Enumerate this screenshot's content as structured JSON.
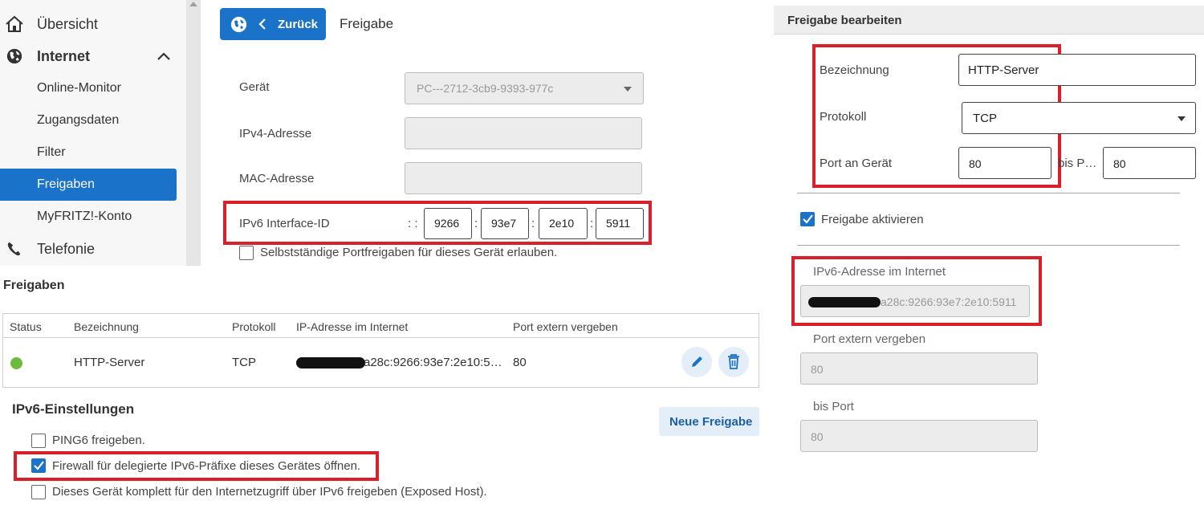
{
  "sidebar": {
    "overview": "Übersicht",
    "internet": "Internet",
    "items": [
      "Online-Monitor",
      "Zugangsdaten",
      "Filter",
      "Freigaben",
      "MyFRITZ!-Konto"
    ],
    "telephony": "Telefonie",
    "active_item": "Freigaben"
  },
  "topbar": {
    "back_label": "Zurück",
    "breadcrumb": "Freigabe"
  },
  "device_form": {
    "device_label": "Gerät",
    "device_value": "PC---2712-3cb9-9393-977c",
    "ipv4_label": "IPv4-Adresse",
    "mac_label": "MAC-Adresse",
    "ipv6_label": "IPv6 Interface-ID",
    "ipv6_prefix": ": :",
    "ipv6_parts": [
      "9266",
      "93e7",
      "2e10",
      "5911"
    ],
    "ipv6_sep": ":",
    "self_release_label": "Selbstständige Portfreigaben für dieses Gerät erlauben."
  },
  "shares": {
    "heading": "Freigaben",
    "columns": [
      "Status",
      "Bezeichnung",
      "Protokoll",
      "IP-Adresse im Internet",
      "Port extern vergeben"
    ],
    "rows": [
      {
        "status_color": "#6dbb3c",
        "name": "HTTP-Server",
        "protocol": "TCP",
        "ip": "a28c:9266:93e7:2e10:5…",
        "port": "80"
      }
    ],
    "new_button": "Neue Freigabe"
  },
  "ipv6_settings": {
    "heading": "IPv6-Einstellungen",
    "options": [
      {
        "label": "PING6 freigeben.",
        "checked": false
      },
      {
        "label": "Firewall für delegierte IPv6-Präfixe dieses Gerätes öffnen.",
        "checked": true
      },
      {
        "label": "Dieses Gerät komplett für den Internetzugriff über IPv6 freigeben (Exposed Host).",
        "checked": false
      }
    ]
  },
  "edit_panel": {
    "title": "Freigabe bearbeiten",
    "name_label": "Bezeichnung",
    "name_value": "HTTP-Server",
    "protocol_label": "Protokoll",
    "protocol_value": "TCP",
    "port_label": "Port an Gerät",
    "port_value": "80",
    "to_port_label": "bis P…",
    "to_port_value": "80",
    "enable_label": "Freigabe aktivieren",
    "enable_checked": true,
    "ipv6_internet_label": "IPv6-Adresse im Internet",
    "ipv6_internet_value": "a28c:9266:93e7:2e10:5911",
    "port_extern_label": "Port extern vergeben",
    "port_extern_value": "80",
    "bis_port_label": "bis Port",
    "bis_port_value": "80"
  },
  "colors": {
    "accent": "#1a73c9",
    "highlight_box": "#d7202a",
    "status_ok": "#6dbb3c"
  }
}
